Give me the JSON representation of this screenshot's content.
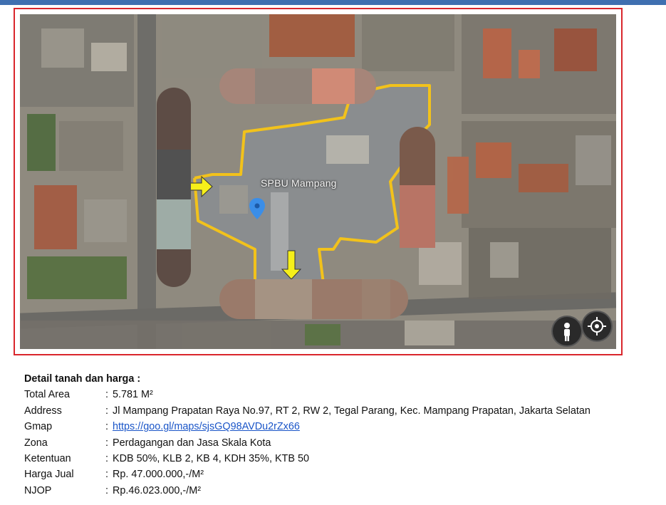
{
  "map": {
    "place_label": "SPBU Mampang",
    "controls": [
      "pegman-icon",
      "my-location-icon"
    ],
    "boundary_color": "#f2c21b",
    "frame_color": "#d9262c"
  },
  "details": {
    "heading": "Detail tanah dan harga :",
    "rows": [
      {
        "label": "Total Area",
        "sep": ":",
        "value": "5.781 M²"
      },
      {
        "label": "Address",
        "sep": ":",
        "value": "Jl Mampang Prapatan Raya No.97, RT 2, RW 2, Tegal Parang, Kec. Mampang Prapatan, Jakarta Selatan"
      },
      {
        "label": "Gmap",
        "sep": ":",
        "value": "https://goo.gl/maps/sjsGQ98AVDu2rZx66"
      },
      {
        "label": "Zona",
        "sep": ":",
        "value": "Perdagangan dan Jasa Skala Kota"
      },
      {
        "label": "Ketentuan",
        "sep": ":",
        "value": "KDB 50%, KLB 2, KB 4, KDH 35%, KTB 50"
      },
      {
        "label": "Harga Jual",
        "sep": ":",
        "value": "Rp. 47.000.000,-/M²"
      },
      {
        "label": "NJOP",
        "sep": ":",
        "value": "Rp.46.023.000,-/M²"
      }
    ]
  }
}
